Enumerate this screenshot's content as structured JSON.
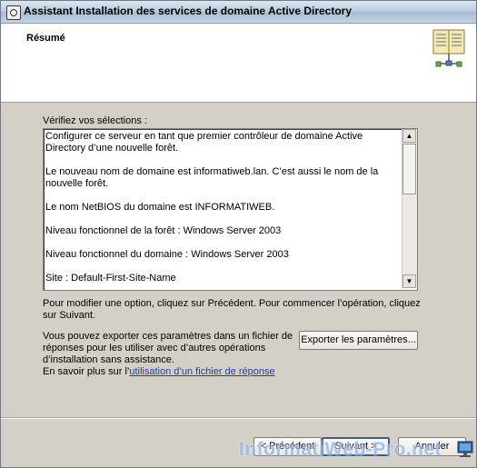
{
  "window": {
    "title": "Assistant Installation des services de domaine Active Directory"
  },
  "header": {
    "title": "Résumé",
    "icon": "book-icon"
  },
  "main": {
    "review_label": "Vérifiez vos sélections :",
    "summary_lines": [
      "Configurer ce serveur en tant que premier contrôleur de domaine Active Directory d’une nouvelle forêt.",
      "Le nouveau nom de domaine est informatiweb.lan. C’est aussi le nom de la nouvelle forêt.",
      "Le nom NetBIOS du domaine est INFORMATIWEB.",
      "Niveau fonctionnel de la forêt : Windows Server 2003",
      "Niveau fonctionnel du domaine : Windows Server 2003",
      "Site : Default-First-Site-Name"
    ],
    "modify_text_1": "Pour modifier une option, cliquez sur Précédent. Pour commencer l’opération, cliquez",
    "modify_text_2": "sur Suivant.",
    "export_text_1": "Vous pouvez exporter ces paramètres dans un fichier de",
    "export_text_2": "réponses pour les utiliser avec d’autres opérations",
    "export_text_3": "d’installation sans assistance.",
    "learn_more_prefix": "En savoir plus sur l’",
    "learn_more_link": "utilisation d’un fichier de réponse",
    "export_button": "Exporter les paramètres..."
  },
  "footer": {
    "back_button": "< Précédent",
    "next_button": "Suivant >",
    "cancel_button": "Annuler"
  },
  "watermark": {
    "text": "InformatiWeb-Pro.net"
  },
  "colors": {
    "link": "#1a3fa8",
    "dialog_bg": "#d4d0c8",
    "header_bg": "#ffffff"
  }
}
